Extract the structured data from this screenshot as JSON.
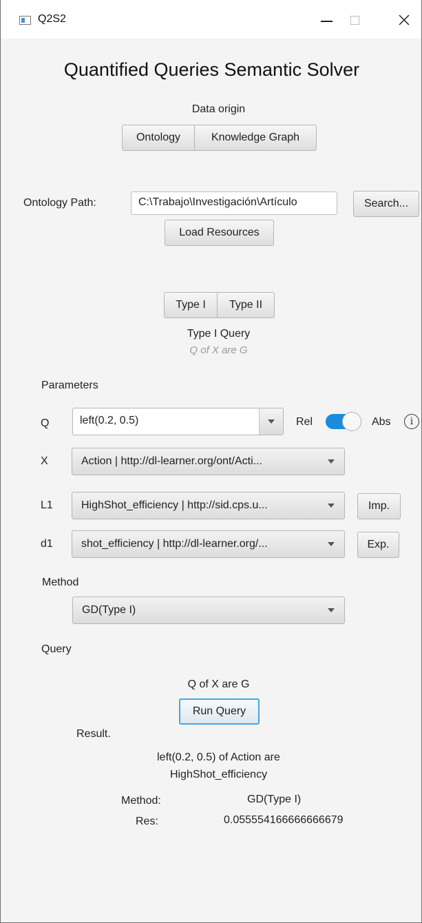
{
  "window": {
    "title": "Q2S2"
  },
  "heading": "Quantified Queries Semantic Solver",
  "data_origin": {
    "label": "Data origin",
    "options": [
      "Ontology",
      "Knowledge Graph"
    ]
  },
  "ontology": {
    "path_label": "Ontology Path:",
    "path_value": "C:\\Trabajo\\Investigación\\Artículo",
    "search_button": "Search...",
    "load_button": "Load Resources"
  },
  "query_type": {
    "options": [
      "Type I",
      "Type II"
    ],
    "title": "Type I Query",
    "pattern": "Q of X are G"
  },
  "parameters": {
    "label": "Parameters",
    "q_label": "Q",
    "q_value": "left(0.2, 0.5)",
    "rel_label": "Rel",
    "abs_label": "Abs",
    "toggle_state": "on",
    "info_glyph": "i",
    "x_label": "X",
    "x_value": "Action | http://dl-learner.org/ont/Acti...",
    "l1_label": "L1",
    "l1_value": "HighShot_efficiency | http://sid.cps.u...",
    "imp_button": "Imp.",
    "d1_label": "d1",
    "d1_value": "shot_efficiency | http://dl-learner.org/...",
    "exp_button": "Exp."
  },
  "method": {
    "label": "Method",
    "value": "GD(Type I)"
  },
  "query": {
    "label": "Query",
    "pattern": "Q of X are G",
    "run_button": "Run Query"
  },
  "result": {
    "label": "Result.",
    "line1": "left(0.2, 0.5) of Action are",
    "line2": "HighShot_efficiency",
    "method_label": "Method:",
    "method_value": "GD(Type I)",
    "res_label": "Res:",
    "res_value": "0.055554166666666679"
  }
}
